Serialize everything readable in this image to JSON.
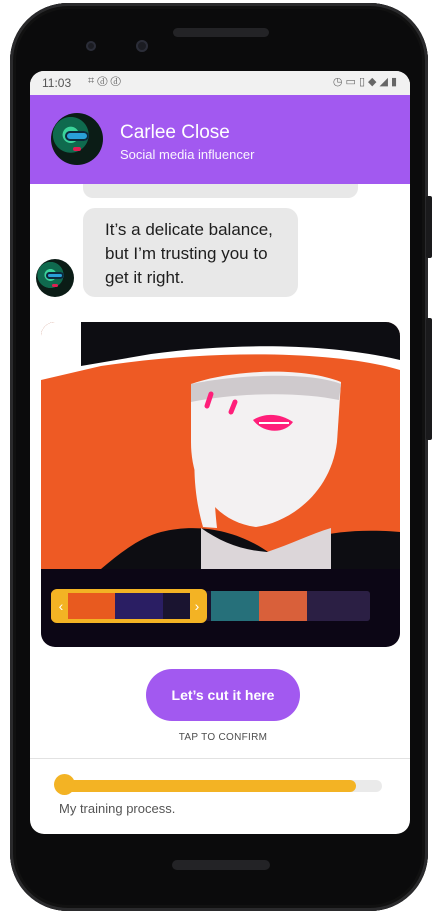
{
  "status_bar": {
    "time": "11:03",
    "left_icons": [
      "notification-icon",
      "network-icon",
      "network-icon"
    ],
    "right_icons": [
      "alarm-icon",
      "cast-icon",
      "vibrate-icon",
      "wifi-icon",
      "signal-icon",
      "battery-icon"
    ]
  },
  "header": {
    "name": "Carlee Close",
    "role": "Social media influencer",
    "color": "#a259f0"
  },
  "message": {
    "lines": [
      "It’s a delicate balance,",
      "but I’m trusting you to",
      "get it right."
    ]
  },
  "media": {
    "filmstrip_selection": [
      "chevron-left-icon",
      "chevron-right-icon"
    ]
  },
  "cta": {
    "label": "Let’s cut it here"
  },
  "hint": {
    "label": "TAP TO CONFIRM"
  },
  "progress": {
    "value": 0.92,
    "label": "My training process.",
    "color": "#f3b324"
  }
}
